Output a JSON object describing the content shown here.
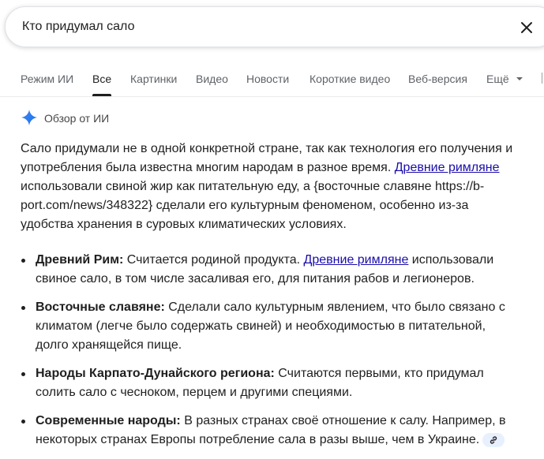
{
  "search": {
    "query": "Кто придумал сало"
  },
  "tabs": [
    {
      "label": "Режим ИИ"
    },
    {
      "label": "Все"
    },
    {
      "label": "Картинки"
    },
    {
      "label": "Видео"
    },
    {
      "label": "Новости"
    },
    {
      "label": "Короткие видео"
    },
    {
      "label": "Веб-версия"
    }
  ],
  "more_tab": "Ещё",
  "ai": {
    "title": "Обзор от ИИ",
    "paragraph": {
      "part1": "Сало придумали не в одной конкретной стране, так как технология его получения и употребления была известна многим народам в разное время. ",
      "link1": "Древние римляне",
      "part2": " использовали свиной жир как питательную еду, а {восточные славяне https://b-port.com/news/348322} сделали его культурным феноменом, особенно из-за удобства хранения в суровых климатических условиях."
    },
    "bullets": [
      {
        "title": "Древний Рим:",
        "text_before": " Считается родиной продукта. ",
        "link": "Древние римляне",
        "text_after": " использовали свиное сало, в том числе засаливая его, для питания рабов и легионеров."
      },
      {
        "title": "Восточные славяне:",
        "text": " Сделали сало культурным явлением, что было связано с климатом (легче было содержать свиней) и необходимостью в питательной, долго хранящейся пище."
      },
      {
        "title": "Народы Карпато-Дунайского региона:",
        "text": " Считаются первыми, кто придумал солить сало с чесноком, перцем и другими специями."
      },
      {
        "title": "Современные народы:",
        "text": " В разных странах своё отношение к салу. Например, в некоторых странах Европы потребление сала в разы выше, чем в Украине."
      }
    ]
  },
  "colors": {
    "link": "#1a0dab",
    "text": "#1f1f1f",
    "muted": "#5f6368",
    "sparkle": "#4285f4"
  }
}
